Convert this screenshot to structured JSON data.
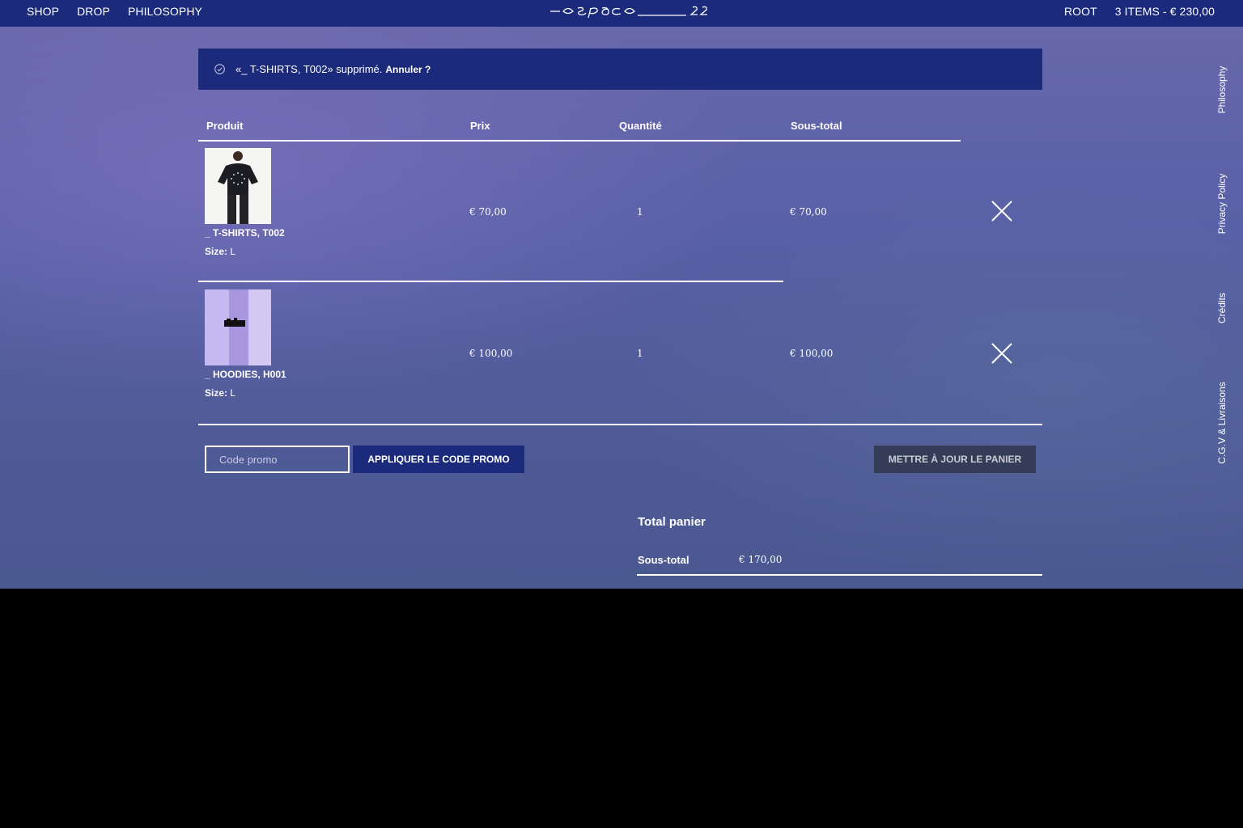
{
  "nav": {
    "left": [
      "SHOP",
      "DROP",
      "PHILOSOPHY"
    ],
    "logo_text": "espace___22",
    "account": "ROOT",
    "cart_summary": "3 ITEMS - € 230,00"
  },
  "notice": {
    "message": "«_ T-SHIRTS, T002» supprimé.",
    "undo": "Annuler ?"
  },
  "cart": {
    "headers": {
      "product": "Produit",
      "price": "Prix",
      "quantity": "Quantité",
      "subtotal": "Sous-total"
    },
    "size_label": "Size:",
    "items": [
      {
        "name": "_ T-SHIRTS, T002",
        "size": "L",
        "price": "€ 70,00",
        "quantity": "1",
        "subtotal": "€ 70,00"
      },
      {
        "name": "_ HOODIES, H001",
        "size": "L",
        "price": "€ 100,00",
        "quantity": "1",
        "subtotal": "€ 100,00"
      }
    ]
  },
  "coupon": {
    "placeholder": "Code promo",
    "apply_label": "APPLIQUER LE CODE PROMO",
    "update_label": "METTRE À JOUR LE PANIER"
  },
  "totals": {
    "title": "Total panier",
    "subtotal_label": "Sous-total",
    "subtotal_value": "€ 170,00"
  },
  "side_links": [
    "Philosophy",
    "Privacy Policy",
    "Crédits",
    "C.G.V & Livraisons"
  ],
  "colors": {
    "navy": "#1c2a7c",
    "background": "#5860a6",
    "update_button": "#343c58"
  }
}
